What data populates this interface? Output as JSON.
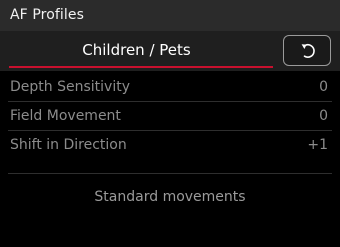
{
  "header": {
    "title": "AF Profiles"
  },
  "profile": {
    "name": "Children / Pets",
    "reset_icon": "reset-arrow-icon"
  },
  "settings": [
    {
      "label": "Depth Sensitivity",
      "value": "0"
    },
    {
      "label": "Field Movement",
      "value": "0"
    },
    {
      "label": "Shift in Direction",
      "value": "+1"
    }
  ],
  "footer": {
    "text": "Standard movements"
  },
  "colors": {
    "accent": "#c8102e",
    "background": "#000000",
    "header_bg": "#2b2b2b",
    "dim_text": "#8c8c8c"
  }
}
